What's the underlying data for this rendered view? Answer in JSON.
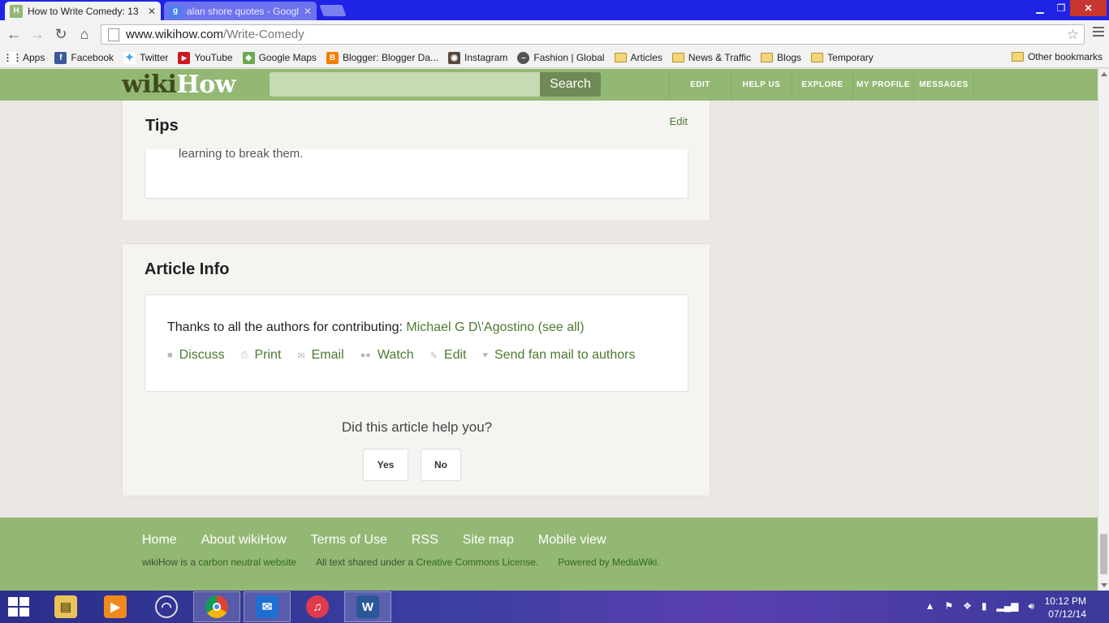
{
  "browser": {
    "tabs": [
      {
        "title": "How to Write Comedy: 13",
        "favicon": "wikihow-icon"
      },
      {
        "title": "alan shore quotes - Googl",
        "favicon": "google-icon"
      }
    ],
    "url_host": "www.wikihow.com",
    "url_path": "/Write-Comedy",
    "bookmarks": [
      {
        "label": "Apps",
        "icon": "apps-grid-icon"
      },
      {
        "label": "Facebook",
        "icon": "facebook-icon"
      },
      {
        "label": "Twitter",
        "icon": "twitter-icon"
      },
      {
        "label": "YouTube",
        "icon": "youtube-icon"
      },
      {
        "label": "Google Maps",
        "icon": "google-maps-icon"
      },
      {
        "label": "Blogger: Blogger Da...",
        "icon": "blogger-icon"
      },
      {
        "label": "Instagram",
        "icon": "instagram-icon"
      },
      {
        "label": "Fashion | Global",
        "icon": "fashion-icon"
      },
      {
        "label": "Articles",
        "icon": "folder-icon"
      },
      {
        "label": "News & Traffic",
        "icon": "folder-icon"
      },
      {
        "label": "Blogs",
        "icon": "folder-icon"
      },
      {
        "label": "Temporary",
        "icon": "folder-icon"
      }
    ],
    "other_bookmarks": "Other bookmarks"
  },
  "header": {
    "logo_wiki": "wiki",
    "logo_how": "How",
    "search_button": "Search",
    "nav": [
      "EDIT",
      "HELP US",
      "EXPLORE",
      "MY PROFILE",
      "MESSAGES"
    ]
  },
  "tips": {
    "title": "Tips",
    "edit": "Edit",
    "text": "learning to break them."
  },
  "article_info": {
    "title": "Article Info",
    "contrib_prefix": "Thanks to all the authors for contributing: ",
    "author": "Michael G D\\'Agostino",
    "see_all_open": "(",
    "see_all": "see all",
    "see_all_close": ")",
    "actions": [
      {
        "label": "Discuss",
        "icon": "discuss-icon"
      },
      {
        "label": "Print",
        "icon": "print-icon"
      },
      {
        "label": "Email",
        "icon": "email-icon"
      },
      {
        "label": "Watch",
        "icon": "watch-icon"
      },
      {
        "label": "Edit",
        "icon": "pencil-icon"
      },
      {
        "label": "Send fan mail to authors",
        "icon": "heart-icon"
      }
    ],
    "help_question": "Did this article help you?",
    "yes": "Yes",
    "no": "No"
  },
  "footer": {
    "links": [
      "Home",
      "About wikiHow",
      "Terms of Use",
      "RSS",
      "Site map",
      "Mobile view"
    ],
    "meta1_prefix": "wikiHow is a ",
    "meta1_link": "carbon neutral website",
    "meta2_prefix": "All text shared under a ",
    "meta2_link": "Creative Commons License.",
    "meta3_link": "Powered by MediaWiki."
  },
  "taskbar": {
    "apps": [
      "file-explorer-icon",
      "media-player-icon",
      "torrent-icon",
      "chrome-icon",
      "mail-icon",
      "itunes-icon",
      "word-icon"
    ],
    "time": "10:12 PM",
    "date": "07/12/14"
  },
  "colors": {
    "tabbar": "#1f23e6",
    "wikihow_green": "#93b874",
    "link_green": "#4b7a30"
  }
}
